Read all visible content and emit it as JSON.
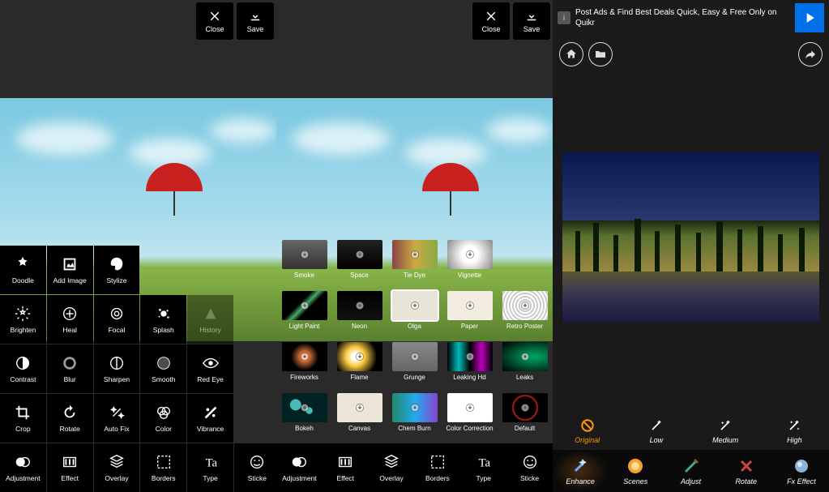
{
  "topbar": {
    "close": "Close",
    "save": "Save"
  },
  "left_tools": {
    "row1": [
      {
        "id": "doodle",
        "label": "Doodle"
      },
      {
        "id": "add-image",
        "label": "Add Image"
      },
      {
        "id": "stylize",
        "label": "Stylize"
      }
    ],
    "row2": [
      {
        "id": "brighten",
        "label": "Brighten"
      },
      {
        "id": "heal",
        "label": "Heal"
      },
      {
        "id": "focal",
        "label": "Focal"
      },
      {
        "id": "splash",
        "label": "Splash"
      },
      {
        "id": "history",
        "label": "History",
        "disabled": true
      }
    ],
    "row3": [
      {
        "id": "contrast",
        "label": "Contrast"
      },
      {
        "id": "blur",
        "label": "Blur"
      },
      {
        "id": "sharpen",
        "label": "Sharpen"
      },
      {
        "id": "smooth",
        "label": "Smooth"
      },
      {
        "id": "redeye",
        "label": "Red Eye"
      }
    ],
    "row4": [
      {
        "id": "crop",
        "label": "Crop"
      },
      {
        "id": "rotate",
        "label": "Rotate"
      },
      {
        "id": "autofix",
        "label": "Auto Fix"
      },
      {
        "id": "color",
        "label": "Color"
      },
      {
        "id": "vibrance",
        "label": "Vibrance"
      }
    ],
    "row5": [
      {
        "id": "adjustment",
        "label": "Adjustment"
      },
      {
        "id": "effect",
        "label": "Effect"
      },
      {
        "id": "overlay",
        "label": "Overlay"
      },
      {
        "id": "borders",
        "label": "Borders"
      },
      {
        "id": "type",
        "label": "Type"
      },
      {
        "id": "sticker",
        "label": "Sticke"
      }
    ]
  },
  "effects": [
    {
      "id": "smoke",
      "label": "Smoke",
      "bg": "linear-gradient(#666,#333)"
    },
    {
      "id": "space",
      "label": "Space",
      "bg": "linear-gradient(#222,#000)"
    },
    {
      "id": "tiedye",
      "label": "Tie Dye",
      "bg": "linear-gradient(90deg,#844,#ca4,#8a4)"
    },
    {
      "id": "vignette",
      "label": "Vignette",
      "bg": "radial-gradient(circle,#fff 30%,#888 100%)"
    },
    {
      "id": "lightpaint",
      "label": "Light Paint",
      "bg": "linear-gradient(135deg,#000 40%,#4a6 50%,#000 60%)"
    },
    {
      "id": "neon",
      "label": "Neon",
      "bg": "linear-gradient(#000,#111)"
    },
    {
      "id": "olga",
      "label": "Olga",
      "bg": "#e8e4d8",
      "selected": true
    },
    {
      "id": "paper",
      "label": "Paper",
      "bg": "#f2ede0"
    },
    {
      "id": "retroposter",
      "label": "Retro Poster",
      "bg": "repeating-radial-gradient(circle,#fff,#fff 2px,#ccc 2px,#ccc 4px)"
    },
    {
      "id": "fireworks",
      "label": "Fireworks",
      "bg": "radial-gradient(circle,#f84 10%,#000 50%)"
    },
    {
      "id": "flame",
      "label": "Flame",
      "bg": "radial-gradient(circle at 40% 50%,#fff 10%,#fc4 30%,#000 70%)"
    },
    {
      "id": "grunge",
      "label": "Grunge",
      "bg": "linear-gradient(#888,#666)"
    },
    {
      "id": "leakinghd",
      "label": "Leaking Hd",
      "bg": "linear-gradient(90deg,#000,#0bb,#000,#b0b,#000)"
    },
    {
      "id": "leaks",
      "label": "Leaks",
      "bg": "radial-gradient(ellipse at 70% 50%,#0a6,#000)"
    },
    {
      "id": "bokeh",
      "label": "Bokeh",
      "bg": "radial-gradient(circle at 30% 40%,#4bb 15%,transparent 16%),radial-gradient(circle at 60% 60%,#4bb 10%,transparent 11%),#022"
    },
    {
      "id": "canvas",
      "label": "Canvas",
      "bg": "#ece6d8"
    },
    {
      "id": "chemburn",
      "label": "Chem Burn",
      "bg": "linear-gradient(90deg,#286,#2ae,#84c)"
    },
    {
      "id": "colorcorrection",
      "label": "Color Correction",
      "bg": "#fff"
    },
    {
      "id": "default",
      "label": "Default",
      "bg": "radial-gradient(circle,transparent 40%,#c22 45%,transparent 50%),#000"
    }
  ],
  "middle_bottom": [
    {
      "id": "adjustment",
      "label": "Adjustment"
    },
    {
      "id": "effect",
      "label": "Effect"
    },
    {
      "id": "overlay",
      "label": "Overlay"
    },
    {
      "id": "borders",
      "label": "Borders"
    },
    {
      "id": "type",
      "label": "Type"
    },
    {
      "id": "sticker",
      "label": "Sticke"
    }
  ],
  "ad": {
    "text": "Post Ads & Find Best Deals Quick, Easy & Free Only on Quikr"
  },
  "intensity": [
    {
      "id": "original",
      "label": "Original",
      "active": true
    },
    {
      "id": "low",
      "label": "Low"
    },
    {
      "id": "medium",
      "label": "Medium"
    },
    {
      "id": "high",
      "label": "High"
    }
  ],
  "tabs": [
    {
      "id": "enhance",
      "label": "Enhance",
      "active": true
    },
    {
      "id": "scenes",
      "label": "Scenes"
    },
    {
      "id": "adjust",
      "label": "Adjust"
    },
    {
      "id": "rotate",
      "label": "Rotate"
    },
    {
      "id": "fxeffect",
      "label": "Fx Effect"
    }
  ]
}
